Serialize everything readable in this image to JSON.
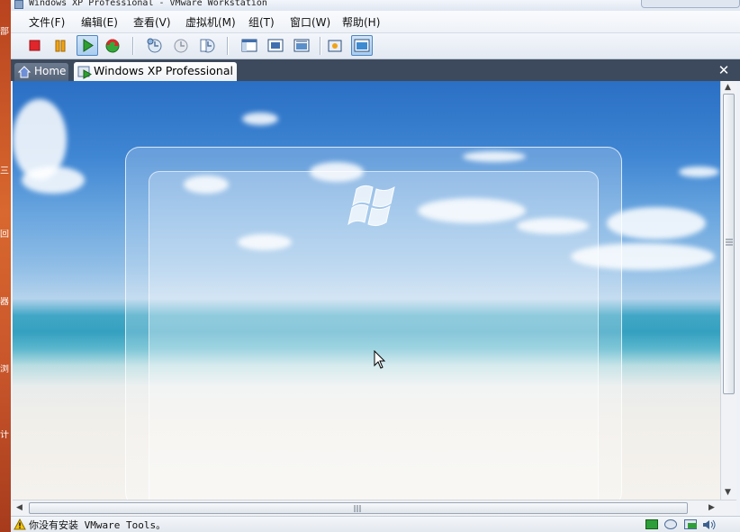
{
  "window": {
    "title": "Windows XP Professional - VMware Workstation"
  },
  "menu": {
    "items": [
      "文件(F)",
      "编辑(E)",
      "查看(V)",
      "虚拟机(M)",
      "组(T)",
      "窗口(W)",
      "帮助(H)"
    ]
  },
  "toolbar": {
    "buttons": [
      "stop-icon",
      "pause-icon",
      "play-icon",
      "reset-icon",
      "snapshot-icon",
      "revert-snapshot-icon",
      "snapshot-manager-icon",
      "show-sidebar-icon",
      "full-screen-icon",
      "quick-switch-icon",
      "summary-view-icon",
      "console-view-icon"
    ],
    "pressed": [
      "play-icon",
      "console-view-icon"
    ]
  },
  "tabs": {
    "home_label": "Home",
    "vm_label": "Windows XP Professional",
    "close_label": "✕"
  },
  "statusbar": {
    "message": "你没有安装 VMware Tools。"
  },
  "desktop": {
    "side_chars": [
      "部",
      "三",
      "回",
      "器",
      "浏",
      "计"
    ]
  },
  "colors": {
    "tab_bar": "#3d4a5d",
    "accent": "#4f85c1",
    "stop": "#e0262b",
    "pause": "#f0a316",
    "play": "#2f9f32",
    "warning": "#f5c400"
  }
}
